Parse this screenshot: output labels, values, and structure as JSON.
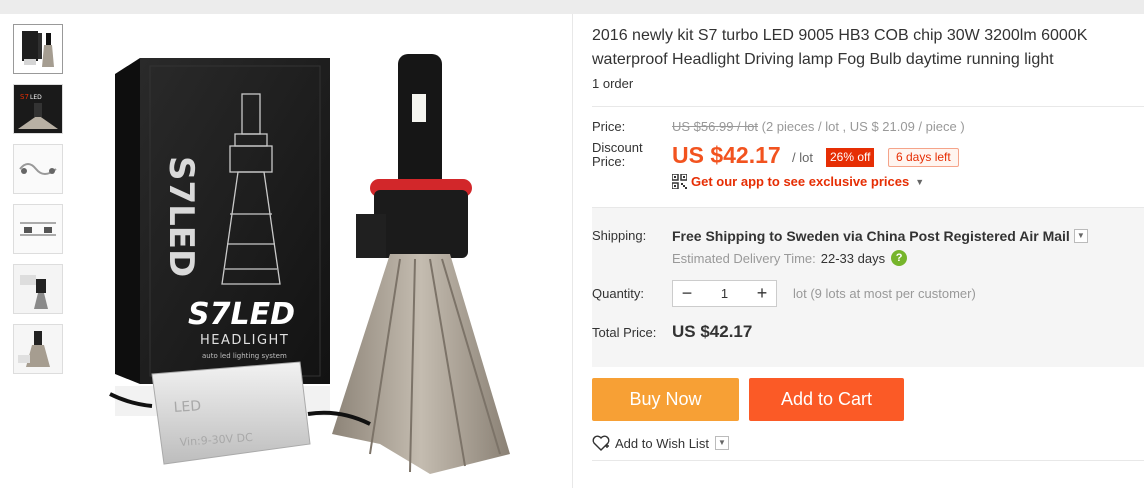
{
  "product": {
    "title": "2016 newly kit S7 turbo LED 9005 HB3 COB chip 30W 3200lm 6000K waterproof Headlight Driving lamp Fog Bulb daytime running light",
    "orders": "1 order",
    "image_brand_text": "S7LED",
    "image_sub_text": "HEADLIGHT",
    "image_tagline": "auto led lighting system"
  },
  "price": {
    "label": "Price:",
    "original": "US $56.99 / lot",
    "original_detail": "(2 pieces / lot , US $ 21.09 / piece )",
    "discount_label": "Discount Price:",
    "discount_value": "US $42.17",
    "per_lot": "/ lot",
    "discount_badge": "26% off",
    "days_left": "6 days left",
    "app_promo": "Get our app to see exclusive prices"
  },
  "shipping": {
    "label": "Shipping:",
    "text_prefix": "Free Shipping to",
    "destination": "Sweden",
    "text_suffix": "via China Post Registered Air Mail",
    "eta_label": "Estimated Delivery Time:",
    "eta_value": "22-33 days"
  },
  "quantity": {
    "label": "Quantity:",
    "value": "1",
    "minus": "−",
    "plus": "+",
    "note": "lot (9 lots at most per customer)"
  },
  "total": {
    "label": "Total Price:",
    "value": "US $42.17"
  },
  "actions": {
    "buy_now": "Buy Now",
    "add_to_cart": "Add to Cart",
    "wishlist": "Add to Wish List"
  },
  "colors": {
    "discount_price": "#f2531f",
    "buy_now": "#f7a035",
    "add_to_cart": "#fb5a26",
    "badge": "#e62e04"
  },
  "icons": {
    "app": "qr-code-icon",
    "help": "help-icon",
    "wishlist": "heart-icon",
    "dropdown": "chevron-down-icon"
  }
}
